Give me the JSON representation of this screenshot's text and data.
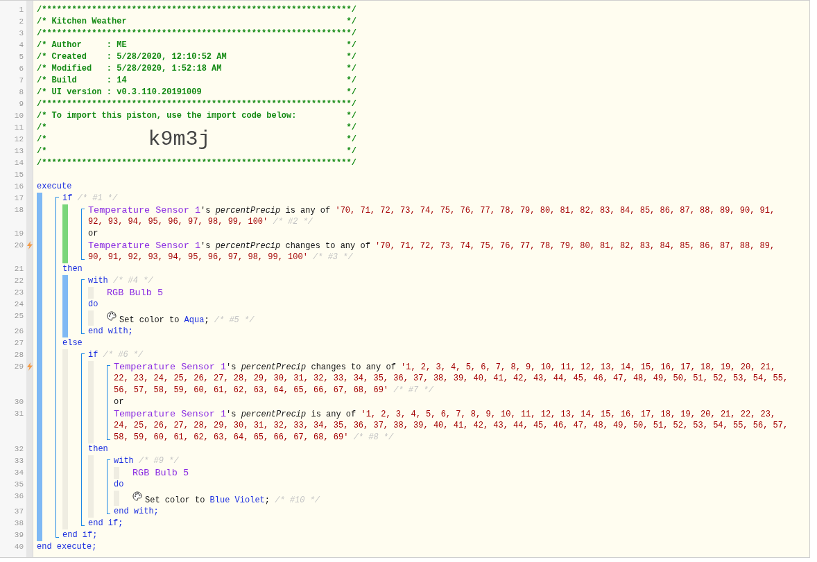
{
  "code": [
    {
      "kind": "banner",
      "number": "1",
      "trigger": false,
      "tokens": [
        {
          "kind": "banner",
          "text": "/**************************************************************/"
        }
      ]
    },
    {
      "kind": "banner",
      "number": "2",
      "trigger": false,
      "tokens": [
        {
          "kind": "banner",
          "text": "/* Kitchen Weather"
        },
        {
          "kind": "banner",
          "text": "*/"
        }
      ]
    },
    {
      "kind": "banner",
      "number": "3",
      "trigger": false,
      "tokens": [
        {
          "kind": "banner",
          "text": "/**************************************************************/"
        }
      ]
    },
    {
      "kind": "banner",
      "number": "4",
      "trigger": false,
      "tokens": [
        {
          "kind": "banner",
          "text": "/* Author     : ME"
        },
        {
          "kind": "banner",
          "text": "*/"
        }
      ]
    },
    {
      "kind": "banner",
      "number": "5",
      "trigger": false,
      "tokens": [
        {
          "kind": "banner",
          "text": "/* Created    : 5/28/2020, 12:10:52 AM"
        },
        {
          "kind": "banner",
          "text": "*/"
        }
      ]
    },
    {
      "kind": "banner",
      "number": "6",
      "trigger": false,
      "tokens": [
        {
          "kind": "banner",
          "text": "/* Modified   : 5/28/2020, 1:52:18 AM"
        },
        {
          "kind": "banner",
          "text": "*/"
        }
      ]
    },
    {
      "kind": "banner",
      "number": "7",
      "trigger": false,
      "tokens": [
        {
          "kind": "banner",
          "text": "/* Build      : 14"
        },
        {
          "kind": "banner",
          "text": "*/"
        }
      ]
    },
    {
      "kind": "banner",
      "number": "8",
      "trigger": false,
      "tokens": [
        {
          "kind": "banner",
          "text": "/* UI version : v0.3.110.20191009"
        },
        {
          "kind": "banner",
          "text": "*/"
        }
      ]
    },
    {
      "kind": "banner",
      "number": "9",
      "trigger": false,
      "tokens": [
        {
          "kind": "banner",
          "text": "/**************************************************************/"
        }
      ]
    },
    {
      "kind": "banner",
      "number": "10",
      "trigger": false,
      "tokens": [
        {
          "kind": "banner",
          "text": "/* To import this piston, use the import code below:"
        },
        {
          "kind": "banner",
          "text": "*/"
        }
      ]
    },
    {
      "kind": "banner",
      "number": "11",
      "trigger": false,
      "tokens": [
        {
          "kind": "banner",
          "text": "/*"
        },
        {
          "kind": "banner",
          "text": "*/"
        }
      ]
    },
    {
      "kind": "banner",
      "number": "12",
      "trigger": false,
      "tokens": [
        {
          "kind": "banner",
          "text": "/*"
        },
        {
          "kind": "import_code",
          "text": "k9m3j"
        },
        {
          "kind": "banner",
          "text": "*/"
        }
      ]
    },
    {
      "kind": "banner",
      "number": "13",
      "trigger": false,
      "tokens": [
        {
          "kind": "banner",
          "text": "/*"
        },
        {
          "kind": "banner",
          "text": "*/"
        }
      ]
    },
    {
      "kind": "banner",
      "number": "14",
      "trigger": false,
      "tokens": [
        {
          "kind": "banner",
          "text": "/**************************************************************/"
        }
      ]
    },
    {
      "kind": "blank",
      "number": "15",
      "trigger": false
    },
    {
      "kind": "line",
      "number": "16",
      "trigger": false,
      "rows": [
        {
          "tokens": [
            {
              "kind": "keyword",
              "text": "execute"
            }
          ]
        }
      ]
    },
    {
      "kind": "section",
      "color": "#7fb9f4",
      "children": [
        {
          "kind": "bracket",
          "children": [
            {
              "kind": "line",
              "number": "17",
              "trigger": false,
              "rows": [
                {
                  "tokens": [
                    {
                      "kind": "keyword",
                      "text": "if"
                    },
                    {
                      "kind": "comment",
                      "text": "/* #1 */"
                    }
                  ]
                }
              ]
            },
            {
              "kind": "section",
              "color": "#7ad67a",
              "children": [
                {
                  "kind": "bracket",
                  "children": [
                    {
                      "kind": "line",
                      "number": "18",
                      "trigger": false,
                      "rows": [
                        {
                          "tokens": [
                            {
                              "kind": "device",
                              "text": "Temperature Sensor 1"
                            },
                            {
                              "kind": "possessive",
                              "text": "'s"
                            },
                            {
                              "kind": "attribute",
                              "text": "percentPrecip"
                            },
                            {
                              "kind": "plain",
                              "text": "is any of"
                            },
                            {
                              "kind": "value",
                              "text": "'70, 71, 72, 73, 74, 75, 76, 77, 78, 79, 80, 81, 82, 83, 84, 85, 86, 87, 88, 89, 90, 91,"
                            }
                          ]
                        },
                        {
                          "tokens": [
                            {
                              "kind": "value",
                              "text": "92, 93, 94, 95, 96, 97, 98, 99, 100'"
                            },
                            {
                              "kind": "comment",
                              "text": "/* #2 */"
                            }
                          ]
                        }
                      ]
                    },
                    {
                      "kind": "line",
                      "number": "19",
                      "trigger": false,
                      "rows": [
                        {
                          "tokens": [
                            {
                              "kind": "plain",
                              "text": "or"
                            }
                          ]
                        }
                      ]
                    },
                    {
                      "kind": "line",
                      "number": "20",
                      "trigger": true,
                      "rows": [
                        {
                          "tokens": [
                            {
                              "kind": "device",
                              "text": "Temperature Sensor 1"
                            },
                            {
                              "kind": "possessive",
                              "text": "'s"
                            },
                            {
                              "kind": "attribute",
                              "text": "percentPrecip"
                            },
                            {
                              "kind": "plain",
                              "text": "changes to any of"
                            },
                            {
                              "kind": "value",
                              "text": "'70, 71, 72, 73, 74, 75, 76, 77, 78, 79, 80, 81, 82, 83, 84, 85, 86, 87, 88, 89,"
                            }
                          ]
                        },
                        {
                          "tokens": [
                            {
                              "kind": "value",
                              "text": "90, 91, 92, 93, 94, 95, 96, 97, 98, 99, 100'"
                            },
                            {
                              "kind": "comment",
                              "text": "/* #3 */"
                            }
                          ]
                        }
                      ]
                    }
                  ]
                }
              ]
            },
            {
              "kind": "line",
              "number": "21",
              "trigger": false,
              "rows": [
                {
                  "tokens": [
                    {
                      "kind": "keyword",
                      "text": "then"
                    }
                  ]
                }
              ]
            },
            {
              "kind": "section",
              "color": "#7fb9f4",
              "children": [
                {
                  "kind": "bracket",
                  "children": [
                    {
                      "kind": "line",
                      "number": "22",
                      "trigger": false,
                      "rows": [
                        {
                          "tokens": [
                            {
                              "kind": "keyword",
                              "text": "with"
                            },
                            {
                              "kind": "comment",
                              "text": "/* #4 */"
                            }
                          ]
                        }
                      ]
                    },
                    {
                      "kind": "section",
                      "color": "#efede2",
                      "children": [
                        {
                          "kind": "line",
                          "number": "23",
                          "trigger": false,
                          "rows": [
                            {
                              "tokens": [
                                {
                                  "kind": "device",
                                  "text": "RGB Bulb 5"
                                }
                              ]
                            }
                          ]
                        }
                      ]
                    },
                    {
                      "kind": "line",
                      "number": "24",
                      "trigger": false,
                      "rows": [
                        {
                          "tokens": [
                            {
                              "kind": "keyword",
                              "text": "do"
                            }
                          ]
                        }
                      ]
                    },
                    {
                      "kind": "section",
                      "color": "#efede2",
                      "children": [
                        {
                          "kind": "action",
                          "number": "25",
                          "trigger": false,
                          "rows": [
                            {
                              "tokens": [
                                {
                                  "kind": "plain",
                                  "text": "Set color to"
                                },
                                {
                                  "kind": "constant",
                                  "text": "Aqua"
                                },
                                {
                                  "kind": "punct",
                                  "text": ";"
                                },
                                {
                                  "kind": "comment",
                                  "text": "/* #5 */"
                                }
                              ]
                            }
                          ]
                        }
                      ]
                    },
                    {
                      "kind": "line",
                      "number": "26",
                      "trigger": false,
                      "rows": [
                        {
                          "tokens": [
                            {
                              "kind": "keyword",
                              "text": "end with;"
                            }
                          ]
                        }
                      ]
                    }
                  ]
                }
              ]
            },
            {
              "kind": "line",
              "number": "27",
              "trigger": false,
              "rows": [
                {
                  "tokens": [
                    {
                      "kind": "keyword",
                      "text": "else"
                    }
                  ]
                }
              ]
            },
            {
              "kind": "section",
              "color": "#efede2",
              "children": [
                {
                  "kind": "bracket",
                  "children": [
                    {
                      "kind": "line",
                      "number": "28",
                      "trigger": false,
                      "rows": [
                        {
                          "tokens": [
                            {
                              "kind": "keyword",
                              "text": "if"
                            },
                            {
                              "kind": "comment",
                              "text": "/* #6 */"
                            }
                          ]
                        }
                      ]
                    },
                    {
                      "kind": "section",
                      "color": "#efede2",
                      "children": [
                        {
                          "kind": "bracket",
                          "children": [
                            {
                              "kind": "line",
                              "number": "29",
                              "trigger": true,
                              "rows": [
                                {
                                  "tokens": [
                                    {
                                      "kind": "device",
                                      "text": "Temperature Sensor 1"
                                    },
                                    {
                                      "kind": "possessive",
                                      "text": "'s"
                                    },
                                    {
                                      "kind": "attribute",
                                      "text": "percentPrecip"
                                    },
                                    {
                                      "kind": "plain",
                                      "text": "changes to any of"
                                    },
                                    {
                                      "kind": "value",
                                      "text": "'1, 2, 3, 4, 5, 6, 7, 8, 9, 10, 11, 12, 13, 14, 15, 16, 17, 18, 19, 20, 21,"
                                    }
                                  ]
                                },
                                {
                                  "tokens": [
                                    {
                                      "kind": "value",
                                      "text": "22, 23, 24, 25, 26, 27, 28, 29, 30, 31, 32, 33, 34, 35, 36, 37, 38, 39, 40, 41, 42, 43, 44, 45, 46, 47, 48, 49, 50, 51, 52, 53, 54, 55,"
                                    }
                                  ]
                                },
                                {
                                  "tokens": [
                                    {
                                      "kind": "value",
                                      "text": "56, 57, 58, 59, 60, 61, 62, 63, 64, 65, 66, 67, 68, 69'"
                                    },
                                    {
                                      "kind": "comment",
                                      "text": "/* #7 */"
                                    }
                                  ]
                                }
                              ]
                            },
                            {
                              "kind": "line",
                              "number": "30",
                              "trigger": false,
                              "rows": [
                                {
                                  "tokens": [
                                    {
                                      "kind": "plain",
                                      "text": "or"
                                    }
                                  ]
                                }
                              ]
                            },
                            {
                              "kind": "line",
                              "number": "31",
                              "trigger": false,
                              "rows": [
                                {
                                  "tokens": [
                                    {
                                      "kind": "device",
                                      "text": "Temperature Sensor 1"
                                    },
                                    {
                                      "kind": "possessive",
                                      "text": "'s"
                                    },
                                    {
                                      "kind": "attribute",
                                      "text": "percentPrecip"
                                    },
                                    {
                                      "kind": "plain",
                                      "text": "is any of"
                                    },
                                    {
                                      "kind": "value",
                                      "text": "'1, 2, 3, 4, 5, 6, 7, 8, 9, 10, 11, 12, 13, 14, 15, 16, 17, 18, 19, 20, 21, 22, 23,"
                                    }
                                  ]
                                },
                                {
                                  "tokens": [
                                    {
                                      "kind": "value",
                                      "text": "24, 25, 26, 27, 28, 29, 30, 31, 32, 33, 34, 35, 36, 37, 38, 39, 40, 41, 42, 43, 44, 45, 46, 47, 48, 49, 50, 51, 52, 53, 54, 55, 56, 57,"
                                    }
                                  ]
                                },
                                {
                                  "tokens": [
                                    {
                                      "kind": "value",
                                      "text": "58, 59, 60, 61, 62, 63, 64, 65, 66, 67, 68, 69'"
                                    },
                                    {
                                      "kind": "comment",
                                      "text": "/* #8 */"
                                    }
                                  ]
                                }
                              ]
                            }
                          ]
                        }
                      ]
                    },
                    {
                      "kind": "line",
                      "number": "32",
                      "trigger": false,
                      "rows": [
                        {
                          "tokens": [
                            {
                              "kind": "keyword",
                              "text": "then"
                            }
                          ]
                        }
                      ]
                    },
                    {
                      "kind": "section",
                      "color": "#efede2",
                      "children": [
                        {
                          "kind": "bracket",
                          "children": [
                            {
                              "kind": "line",
                              "number": "33",
                              "trigger": false,
                              "rows": [
                                {
                                  "tokens": [
                                    {
                                      "kind": "keyword",
                                      "text": "with"
                                    },
                                    {
                                      "kind": "comment",
                                      "text": "/* #9 */"
                                    }
                                  ]
                                }
                              ]
                            },
                            {
                              "kind": "section",
                              "color": "#efede2",
                              "children": [
                                {
                                  "kind": "line",
                                  "number": "34",
                                  "trigger": false,
                                  "rows": [
                                    {
                                      "tokens": [
                                        {
                                          "kind": "device",
                                          "text": "RGB Bulb 5"
                                        }
                                      ]
                                    }
                                  ]
                                }
                              ]
                            },
                            {
                              "kind": "line",
                              "number": "35",
                              "trigger": false,
                              "rows": [
                                {
                                  "tokens": [
                                    {
                                      "kind": "keyword",
                                      "text": "do"
                                    }
                                  ]
                                }
                              ]
                            },
                            {
                              "kind": "section",
                              "color": "#efede2",
                              "children": [
                                {
                                  "kind": "action",
                                  "number": "36",
                                  "trigger": false,
                                  "rows": [
                                    {
                                      "tokens": [
                                        {
                                          "kind": "plain",
                                          "text": "Set color to"
                                        },
                                        {
                                          "kind": "constant",
                                          "text": "Blue Violet"
                                        },
                                        {
                                          "kind": "punct",
                                          "text": ";"
                                        },
                                        {
                                          "kind": "comment",
                                          "text": "/* #10 */"
                                        }
                                      ]
                                    }
                                  ]
                                }
                              ]
                            },
                            {
                              "kind": "line",
                              "number": "37",
                              "trigger": false,
                              "rows": [
                                {
                                  "tokens": [
                                    {
                                      "kind": "keyword",
                                      "text": "end with;"
                                    }
                                  ]
                                }
                              ]
                            }
                          ]
                        }
                      ]
                    },
                    {
                      "kind": "line",
                      "number": "38",
                      "trigger": false,
                      "rows": [
                        {
                          "tokens": [
                            {
                              "kind": "keyword",
                              "text": "end if;"
                            }
                          ]
                        }
                      ]
                    }
                  ]
                }
              ]
            },
            {
              "kind": "line",
              "number": "39",
              "trigger": false,
              "rows": [
                {
                  "tokens": [
                    {
                      "kind": "keyword",
                      "text": "end if;"
                    }
                  ]
                }
              ]
            }
          ]
        }
      ]
    },
    {
      "kind": "line",
      "number": "40",
      "trigger": false,
      "rows": [
        {
          "tokens": [
            {
              "kind": "keyword",
              "text": "end execute;"
            }
          ]
        }
      ]
    }
  ]
}
